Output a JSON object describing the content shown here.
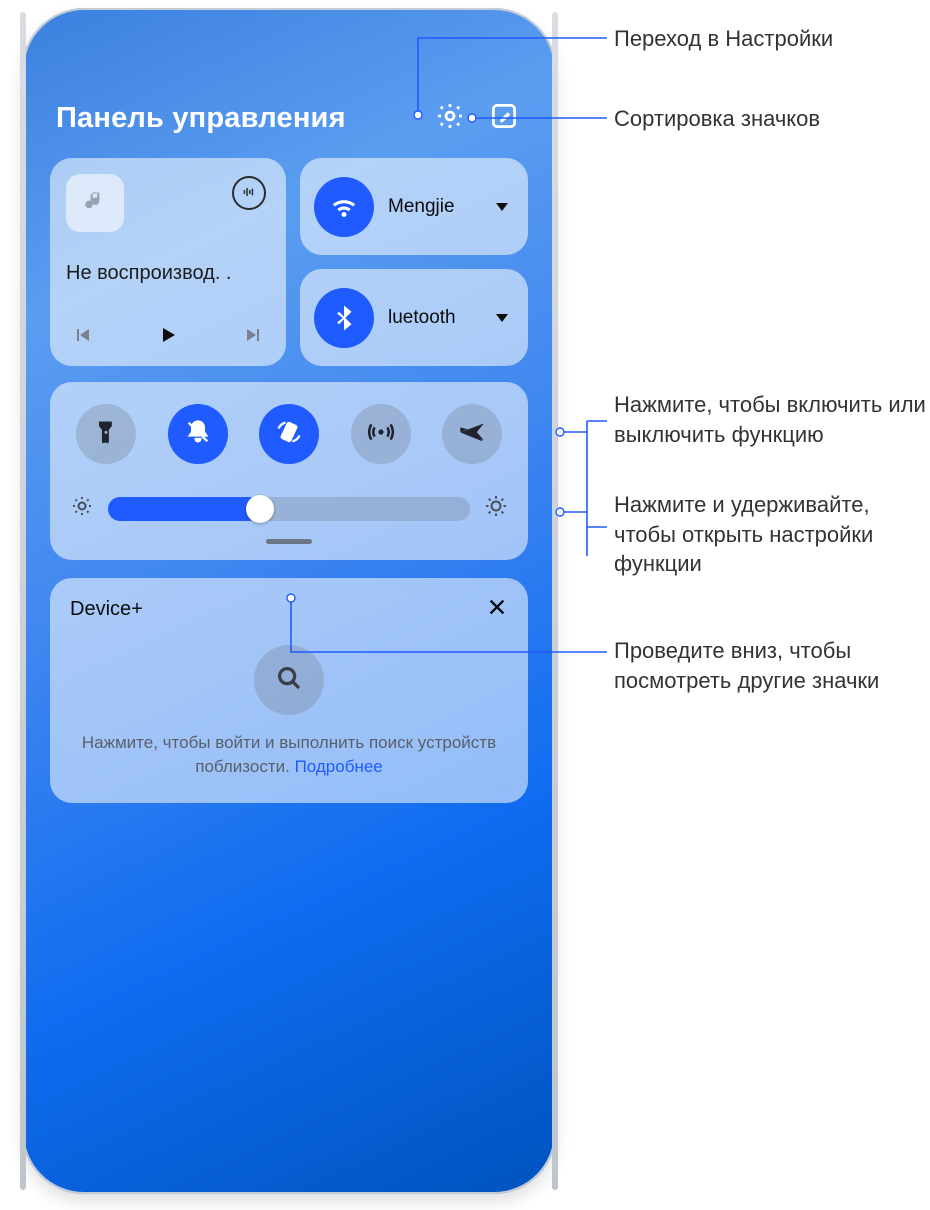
{
  "header": {
    "title": "Панель управления",
    "settings_icon": "gear-icon",
    "sort_icon": "edit-icon"
  },
  "media": {
    "status": "Не воспроизвод. .",
    "album_icon": "music-note-icon",
    "cast_icon": "cast-audio-icon",
    "prev_icon": "skip-prev-icon",
    "play_icon": "play-icon",
    "next_icon": "skip-next-icon"
  },
  "wifi": {
    "label": "Mengjie",
    "icon": "wifi-icon"
  },
  "bluetooth": {
    "label": "luetooth",
    "icon": "bluetooth-icon"
  },
  "toggles": {
    "flashlight": {
      "on": false,
      "icon": "flashlight-icon"
    },
    "mute": {
      "on": true,
      "icon": "bell-off-icon"
    },
    "rotate": {
      "on": true,
      "icon": "auto-rotate-icon"
    },
    "hotspot": {
      "on": false,
      "icon": "hotspot-icon"
    },
    "airplane": {
      "on": false,
      "icon": "airplane-icon"
    }
  },
  "brightness": {
    "percent": 42,
    "low_icon": "sun-low-icon",
    "high_icon": "sun-high-icon"
  },
  "device": {
    "title": "Device+",
    "close_icon": "close-icon",
    "search_icon": "search-icon",
    "message_before": "Нажмите, чтобы войти и выполнить поиск устройств поблизости. ",
    "message_link": "Подробнее"
  },
  "callouts": {
    "settings": "Переход в Настройки",
    "sort": "Сортировка значков",
    "tap": "Нажмите, чтобы включить или выключить функцию",
    "hold": "Нажмите и удерживайте, чтобы открыть настройки функции",
    "swipe": "Проведите вниз, чтобы посмотреть другие значки"
  },
  "colors": {
    "accent": "#1f5bff"
  }
}
